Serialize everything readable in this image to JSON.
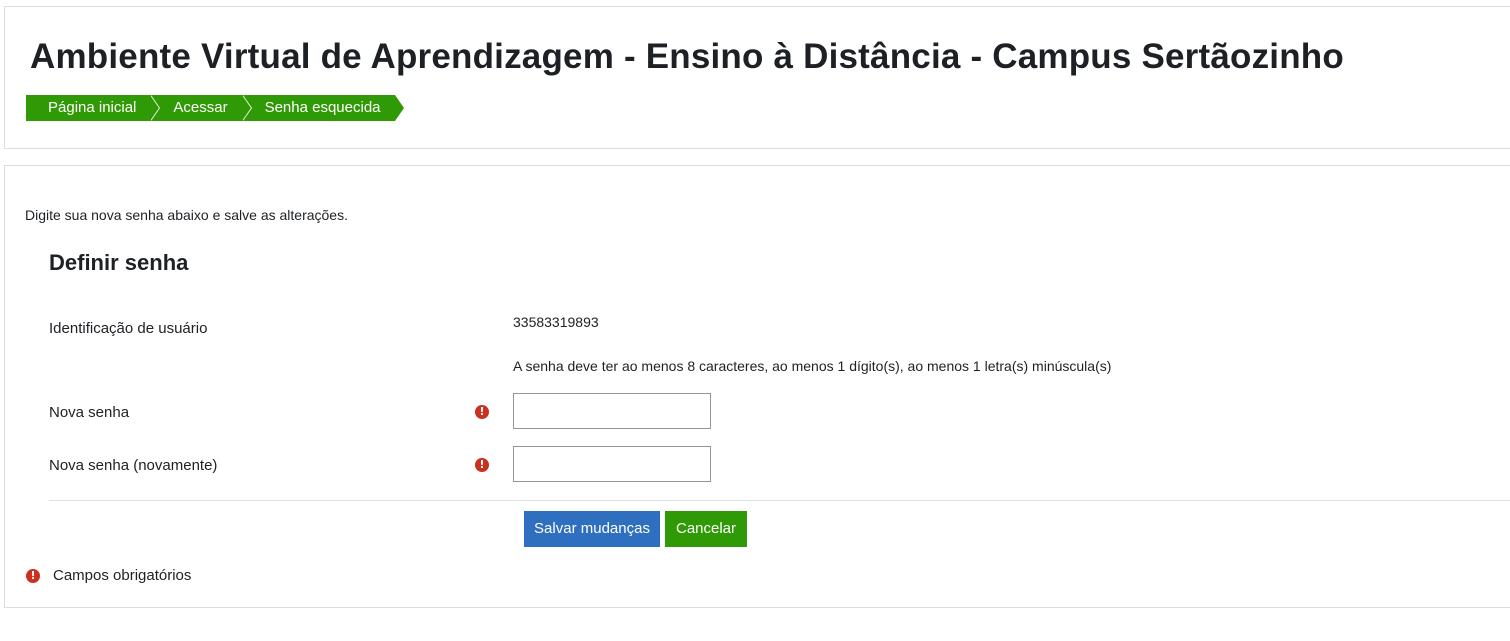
{
  "header": {
    "title": "Ambiente Virtual de Aprendizagem - Ensino à Distância - Campus Sertãozinho",
    "breadcrumb": [
      {
        "label": "Página inicial"
      },
      {
        "label": "Acessar"
      },
      {
        "label": "Senha esquecida"
      }
    ]
  },
  "main": {
    "intro": "Digite sua nova senha abaixo e salve as alterações.",
    "legend": "Definir senha",
    "fields": {
      "username_label": "Identificação de usuário",
      "username_value": "33583319893",
      "policy_text": "A senha deve ter ao menos 8 caracteres, ao menos 1 dígito(s), ao menos 1 letra(s) minúscula(s)",
      "new_password_label": "Nova senha",
      "new_password_value": "",
      "new_password_again_label": "Nova senha (novamente)",
      "new_password_again_value": ""
    },
    "buttons": {
      "save_label": "Salvar mudanças",
      "cancel_label": "Cancelar"
    },
    "required_note": "Campos obrigatórios",
    "required_icon_glyph": "!"
  },
  "colors": {
    "breadcrumb_bg": "#2f9a06",
    "save_button_bg": "#2f6fbf",
    "cancel_button_bg": "#2f9a06",
    "required_icon": "#ca3120"
  },
  "icons": {
    "required": "exclamation-circle-icon",
    "breadcrumb_separator": "chevron-right-icon"
  }
}
